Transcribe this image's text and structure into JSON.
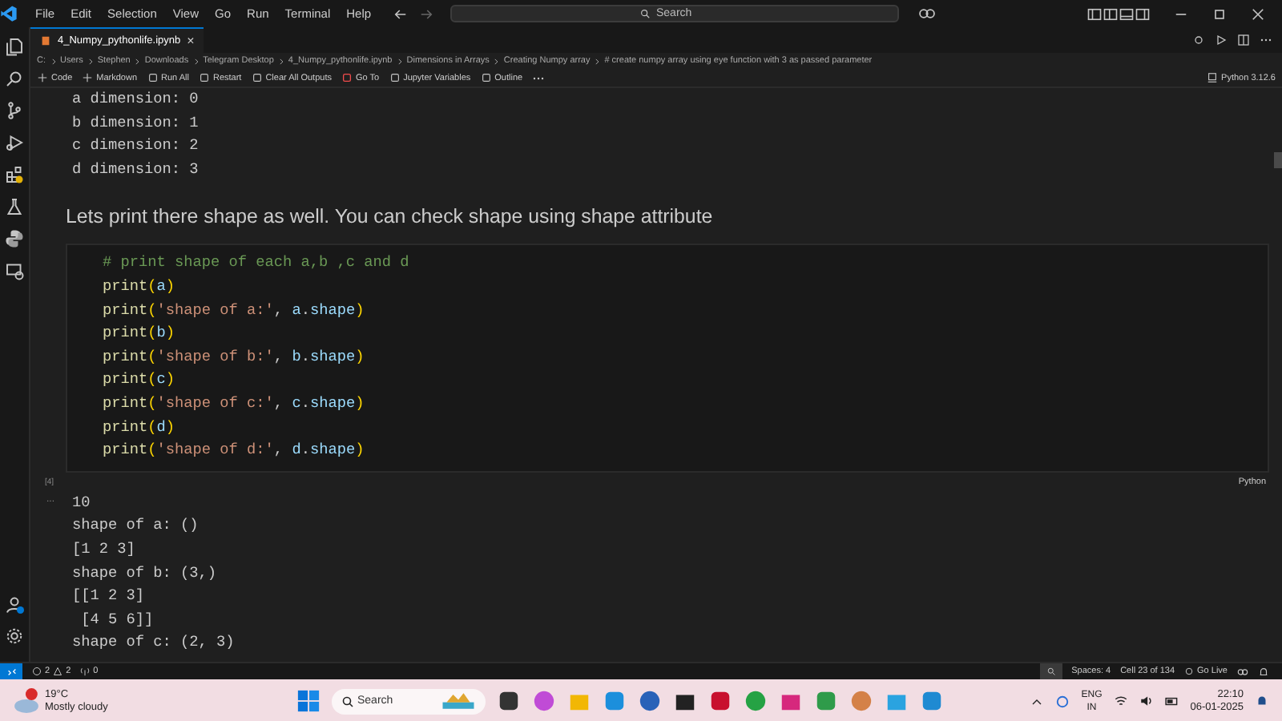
{
  "menu": [
    "File",
    "Edit",
    "Selection",
    "View",
    "Go",
    "Run",
    "Terminal",
    "Help"
  ],
  "search": {
    "placeholder": "Search"
  },
  "tab": {
    "label": "4_Numpy_pythonlife.ipynb",
    "close": "×"
  },
  "breadcrumbs": [
    "C:",
    "Users",
    "Stephen",
    "Downloads",
    "Telegram Desktop",
    "4_Numpy_pythonlife.ipynb",
    "Dimensions in Arrays",
    "Creating Numpy array",
    "# create numpy array using eye function with 3 as passed parameter"
  ],
  "toolbar": [
    "Code",
    "Markdown",
    "Run All",
    "Restart",
    "Clear All Outputs",
    "Go To",
    "Jupyter Variables",
    "Outline"
  ],
  "kernel": "Python 3.12.6",
  "output_top": [
    "a dimension: 0",
    "b dimension: 1",
    "c dimension: 2",
    "d dimension: 3"
  ],
  "markdown": "Lets print there shape as well. You can check shape using shape attribute",
  "code": [
    [
      {
        "t": "# print shape of each a,b ,c and d",
        "kind": "comment"
      }
    ],
    [
      {
        "t": "print",
        "kind": "fn"
      },
      {
        "t": "(",
        "kind": "paren"
      },
      {
        "t": "a",
        "kind": "var"
      },
      {
        "t": ")",
        "kind": "paren"
      }
    ],
    [
      {
        "t": "print",
        "kind": "fn"
      },
      {
        "t": "(",
        "kind": "paren"
      },
      {
        "t": "'shape of a:'",
        "kind": "str"
      },
      {
        "t": ", ",
        "kind": "plain"
      },
      {
        "t": "a",
        "kind": "var"
      },
      {
        "t": ".",
        "kind": "plain"
      },
      {
        "t": "shape",
        "kind": "var"
      },
      {
        "t": ")",
        "kind": "paren"
      }
    ],
    [
      {
        "t": "print",
        "kind": "fn"
      },
      {
        "t": "(",
        "kind": "paren"
      },
      {
        "t": "b",
        "kind": "var"
      },
      {
        "t": ")",
        "kind": "paren"
      }
    ],
    [
      {
        "t": "print",
        "kind": "fn"
      },
      {
        "t": "(",
        "kind": "paren"
      },
      {
        "t": "'shape of b:'",
        "kind": "str"
      },
      {
        "t": ", ",
        "kind": "plain"
      },
      {
        "t": "b",
        "kind": "var"
      },
      {
        "t": ".",
        "kind": "plain"
      },
      {
        "t": "shape",
        "kind": "var"
      },
      {
        "t": ")",
        "kind": "paren"
      }
    ],
    [
      {
        "t": "print",
        "kind": "fn"
      },
      {
        "t": "(",
        "kind": "paren"
      },
      {
        "t": "c",
        "kind": "var"
      },
      {
        "t": ")",
        "kind": "paren"
      }
    ],
    [
      {
        "t": "print",
        "kind": "fn"
      },
      {
        "t": "(",
        "kind": "paren"
      },
      {
        "t": "'shape of c:'",
        "kind": "str"
      },
      {
        "t": ", ",
        "kind": "plain"
      },
      {
        "t": "c",
        "kind": "var"
      },
      {
        "t": ".",
        "kind": "plain"
      },
      {
        "t": "shape",
        "kind": "var"
      },
      {
        "t": ")",
        "kind": "paren"
      }
    ],
    [
      {
        "t": "print",
        "kind": "fn"
      },
      {
        "t": "(",
        "kind": "paren"
      },
      {
        "t": "d",
        "kind": "var"
      },
      {
        "t": ")",
        "kind": "paren"
      }
    ],
    [
      {
        "t": "print",
        "kind": "fn"
      },
      {
        "t": "(",
        "kind": "paren"
      },
      {
        "t": "'shape of d:'",
        "kind": "str"
      },
      {
        "t": ", ",
        "kind": "plain"
      },
      {
        "t": "d",
        "kind": "var"
      },
      {
        "t": ".",
        "kind": "plain"
      },
      {
        "t": "shape",
        "kind": "var"
      },
      {
        "t": ")",
        "kind": "paren"
      }
    ]
  ],
  "cell_exec": "[4]",
  "cell_lang": "Python",
  "output_more": "...",
  "output": [
    "10",
    "shape of a: ()",
    "[1 2 3]",
    "shape of b: (3,)",
    "[[1 2 3]",
    " [4 5 6]]",
    "shape of c: (2, 3)"
  ],
  "status": {
    "errors": "2",
    "warnings": "2",
    "ports": "0",
    "spaces": "Spaces: 4",
    "cell": "Cell 23 of 134",
    "golive": "Go Live"
  },
  "weather": {
    "temp": "19°C",
    "text": "Mostly cloudy"
  },
  "taskbar_search": {
    "placeholder": "Search"
  },
  "tray": {
    "lang": "ENG",
    "region": "IN",
    "time": "22:10",
    "date": "06-01-2025"
  }
}
